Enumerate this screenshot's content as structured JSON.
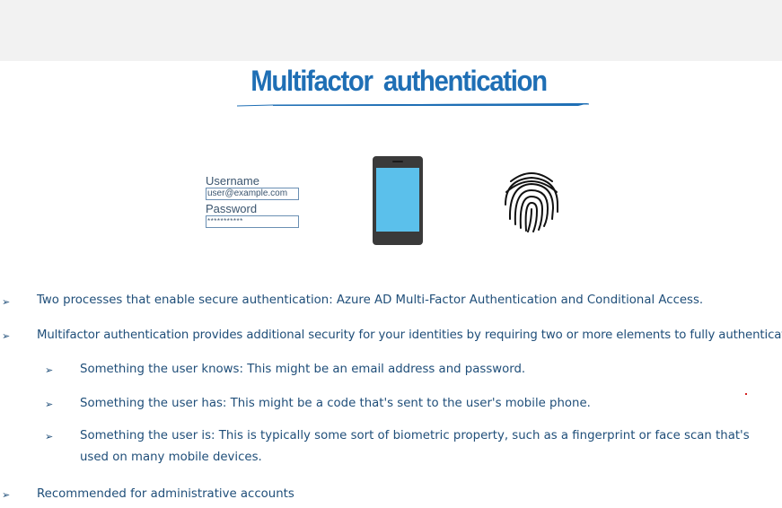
{
  "slide": {
    "title": "Multifactor authentication",
    "login": {
      "username_label": "Username",
      "username_value": "user@example.com",
      "password_label": "Password",
      "password_value": "***********"
    },
    "bullets": [
      "Two processes that enable secure authentication: Azure AD Multi-Factor Authentication and Conditional Access.",
      "Multifactor authentication provides additional security for your identities by requiring two or more elements to fully authenticate.",
      "Recommended for administrative accounts"
    ],
    "sub_bullets": [
      "Something the user knows: This might be an email address and password.",
      "Something the user has: This might be a code that's sent to the user's mobile phone.",
      "Something the user is: This is typically some sort of biometric property, such as a fingerprint or face scan that's used on many mobile devices."
    ],
    "icons": [
      "login-form-icon",
      "mobile-phone-icon",
      "fingerprint-icon",
      "arrow-bullet-icon"
    ],
    "colors": {
      "title": "#1f6fb5",
      "text": "#1f4e79",
      "phone_screen": "#5bc0eb",
      "phone_body": "#3a3a3a",
      "top_band": "#f2f2f2"
    }
  }
}
